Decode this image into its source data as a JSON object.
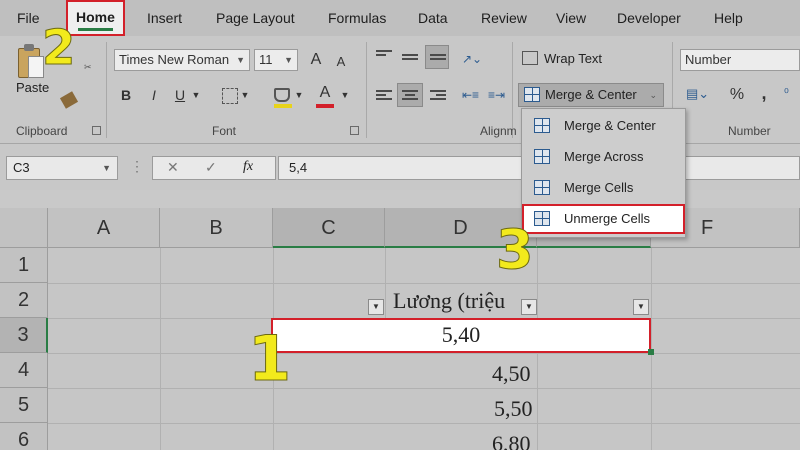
{
  "menu": {
    "items": [
      "File",
      "Home",
      "Insert",
      "Page Layout",
      "Formulas",
      "Data",
      "Review",
      "View",
      "Developer",
      "Help"
    ],
    "active": "Home"
  },
  "ribbon": {
    "clipboard": {
      "paste_label": "Paste",
      "group_label": "Clipboard"
    },
    "font": {
      "family": "Times New Roman",
      "size": "11",
      "group_label": "Font",
      "grow": "A",
      "shrink": "A",
      "bold": "B",
      "italic": "I",
      "underline": "U",
      "font_color": "A"
    },
    "alignment": {
      "wrap_text": "Wrap Text",
      "merge_center": "Merge & Center",
      "group_label": "Alignm"
    },
    "number": {
      "format": "Number",
      "percent": "%",
      "comma": ",",
      "group_label": "Number"
    }
  },
  "formula_bar": {
    "name_box": "C3",
    "cancel": "✕",
    "enter": "✓",
    "fx": "fx",
    "value": "5,4"
  },
  "grid": {
    "columns": [
      "A",
      "B",
      "C",
      "D",
      "E",
      "F"
    ],
    "rows": [
      "1",
      "2",
      "3",
      "4",
      "5",
      "6"
    ],
    "header_text": "Lương (triệu",
    "active_value": "5,40",
    "values": [
      "4,50",
      "5,50",
      "6,80"
    ]
  },
  "merge_menu": {
    "items": [
      "Merge & Center",
      "Merge Across",
      "Merge Cells",
      "Unmerge Cells"
    ],
    "highlighted": "Unmerge Cells"
  },
  "annotations": [
    "1",
    "2",
    "3"
  ],
  "colors": {
    "highlight_red": "#d3202a",
    "annotation_yellow": "#f2ea1c",
    "excel_green": "#2a7d45"
  }
}
